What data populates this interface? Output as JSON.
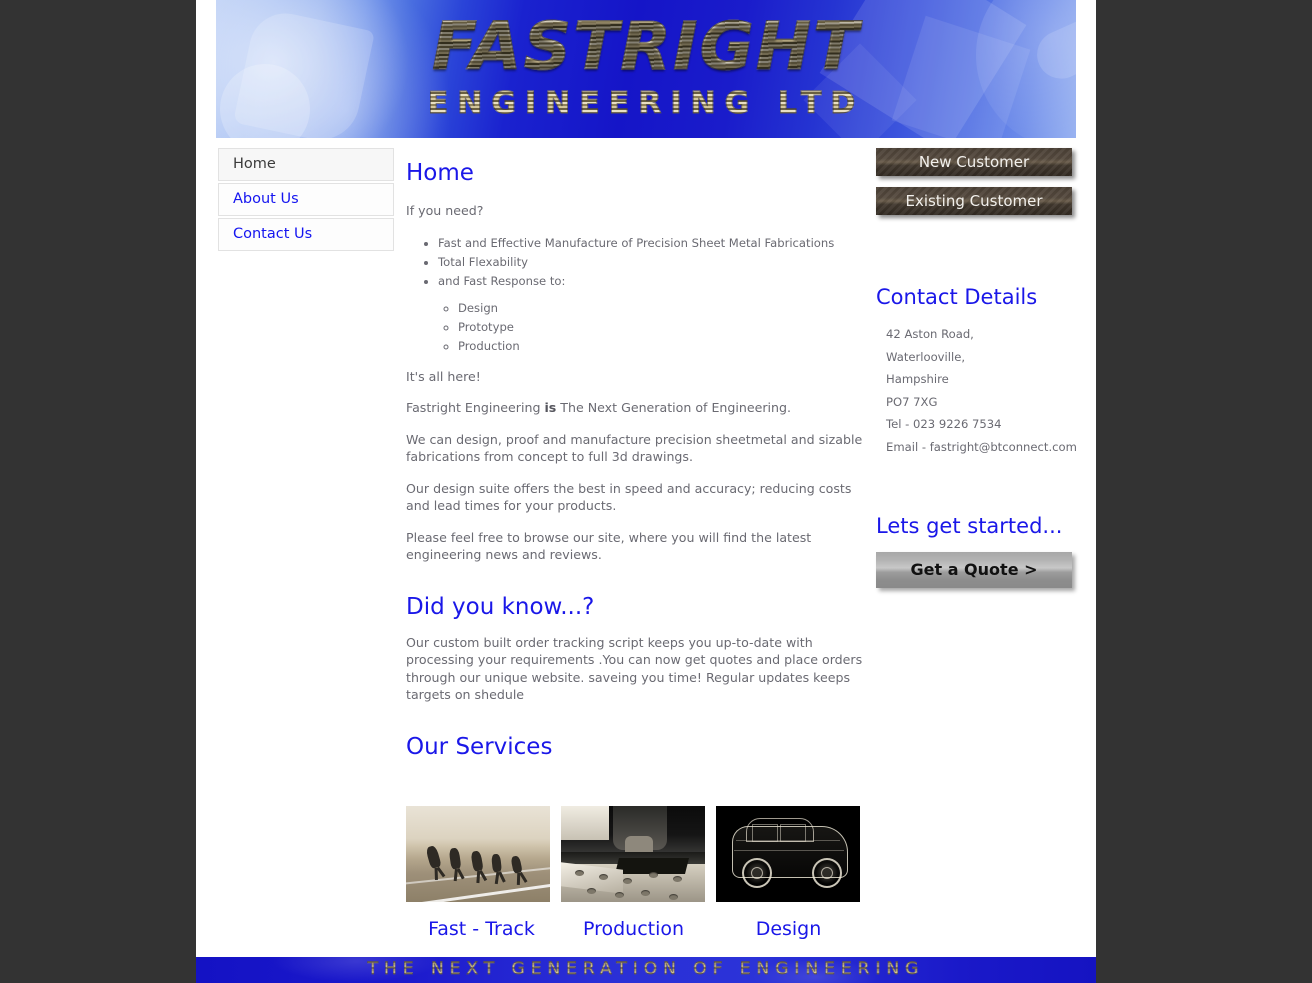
{
  "site": {
    "banner_title": "FASTRIGHT",
    "banner_subtitle": "ENGINEERING LTD",
    "footer_text": "THE NEXT GENERATION OF ENGINEERING"
  },
  "nav": {
    "items": [
      {
        "label": "Home",
        "active": true
      },
      {
        "label": "About Us",
        "active": false
      },
      {
        "label": "Contact Us",
        "active": false
      }
    ]
  },
  "main": {
    "page_title": "Home",
    "intro": "If you need?",
    "needs_list": [
      "Fast and Effective Manufacture of Precision Sheet Metal Fabrications",
      "Total Flexability",
      "and Fast Response to:"
    ],
    "response_list": [
      "Design",
      "Prototype",
      "Production"
    ],
    "para_all_here": "It's all here!",
    "para_tagline_pre": "Fastright Engineering ",
    "para_tagline_bold": "is",
    "para_tagline_post": " The Next Generation of Engineering.",
    "para_design": "We can design, proof and manufacture precision sheetmetal and sizable fabrications from concept to full 3d drawings.",
    "para_suite": "Our design suite offers the best in speed and accuracy; reducing costs and lead times for your products.",
    "para_browse": "Please feel free to browse our site, where you will find the latest engineering news and reviews.",
    "did_you_know_title": "Did you know...?",
    "did_you_know_text": "Our custom built order tracking script keeps you up-to-date with processing your requirements .You can now get quotes and place orders through our unique website.  saveing you time! Regular updates keeps targets on shedule",
    "services_title": "Our Services",
    "services": [
      {
        "label": "Fast - Track",
        "image": "runners-photo"
      },
      {
        "label": "Production",
        "image": "cnc-punch-machine-photo"
      },
      {
        "label": "Design",
        "image": "car-wireframe-photo"
      }
    ]
  },
  "sidebar": {
    "new_customer_label": "New Customer",
    "existing_customer_label": "Existing Customer",
    "contact_title": "Contact Details",
    "contact_lines": [
      "42 Aston Road,",
      "Waterlooville,",
      "Hampshire",
      "PO7 7XG",
      "Tel - 023 9226 7534",
      "Email - fastright@btconnect.com"
    ],
    "start_title": "Lets get started...",
    "quote_button_label": "Get a Quote >"
  },
  "colors": {
    "heading_blue": "#1a17e8",
    "link_blue": "#1515f0",
    "body_gray": "#6a6a72",
    "page_bg": "#ffffff",
    "outer_bg": "#333333",
    "banner_blue": "#1515c8",
    "button_brown": "#554a3e",
    "button_gray": "#b3b3b3"
  }
}
